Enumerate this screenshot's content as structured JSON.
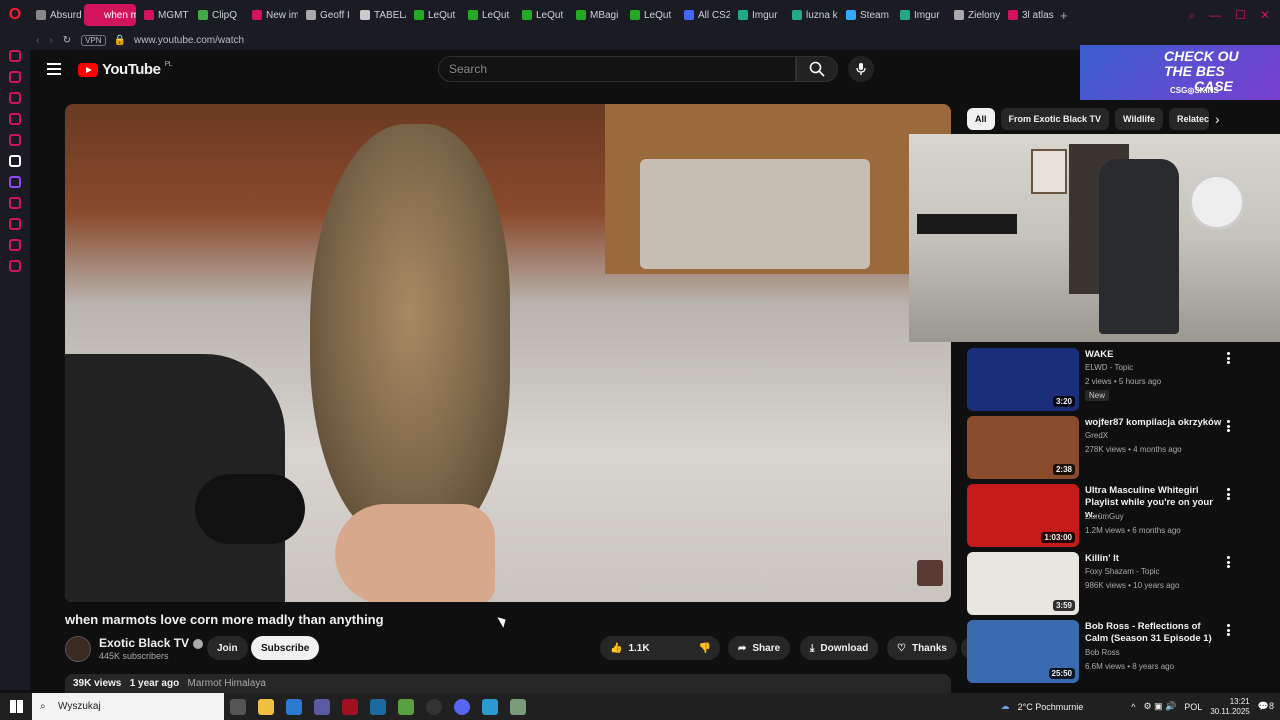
{
  "browser": {
    "tabs": [
      "Absurd",
      "when mar",
      "MGMT",
      "ClipQ",
      "New im",
      "Geoff I",
      "TABEL/",
      "LeQut",
      "LeQut",
      "LeQut",
      "MBagi",
      "LeQut",
      "All CS2",
      "Imgur",
      "luzna k",
      "Steam",
      "Imgur",
      "Zielony",
      "3l atlas"
    ],
    "active_tab_index": 1,
    "vpn_label": "VPN",
    "url": "www.youtube.com/watch",
    "accent_color": "#d4145a"
  },
  "youtube": {
    "logo_text": "YouTube",
    "region": "PL",
    "search_placeholder": "Search"
  },
  "ad": {
    "line1": "CHECK OU",
    "line2": "THE BES",
    "line3": "CASE",
    "brand": "CSG◎SKINS"
  },
  "video": {
    "title": "when marmots love corn more madly than anything",
    "channel": "Exotic Black TV",
    "subscribers": "445K subscribers",
    "join_label": "Join",
    "subscribe_label": "Subscribe",
    "likes": "1.1K",
    "share_label": "Share",
    "download_label": "Download",
    "thanks_label": "Thanks",
    "views": "39K views",
    "age": "1 year ago",
    "tag": "Marmot Himalaya"
  },
  "chips": [
    "All",
    "From Exotic Black TV",
    "Wildlife",
    "Relatec"
  ],
  "recommendations": [
    {
      "title": "WAKE",
      "channel": "ELWD - Topic",
      "meta": "2 views • 5 hours ago",
      "duration": "3:20",
      "badge": "New",
      "color": "#1b2e7a"
    },
    {
      "title": "wojfer87 kompilacja okrzyków",
      "channel": "GredX",
      "meta": "278K views • 4 months ago",
      "duration": "2:38",
      "badge": "",
      "color": "#8a4a2c"
    },
    {
      "title": "Ultra Masculine Whitegirl Playlist while you're on your w...",
      "channel": "DürümGuy",
      "meta": "1.2M views • 6 months ago",
      "duration": "1:03:00",
      "badge": "",
      "color": "#c41a1a"
    },
    {
      "title": "Killin' It",
      "channel": "Foxy Shazam - Topic",
      "meta": "986K views • 10 years ago",
      "duration": "3:59",
      "badge": "",
      "color": "#e9e6df"
    },
    {
      "title": "Bob Ross - Reflections of Calm (Season 31 Episode 1)",
      "channel": "Bob Ross",
      "meta": "6.6M views • 8 years ago",
      "duration": "25:50",
      "badge": "",
      "color": "#3a6ab0"
    }
  ],
  "taskbar": {
    "search_placeholder": "Wyszukaj",
    "weather": "2°C  Pochmurnie",
    "lang": "POL",
    "time": "13:21",
    "date": "30.11.2025",
    "notif": "8"
  }
}
